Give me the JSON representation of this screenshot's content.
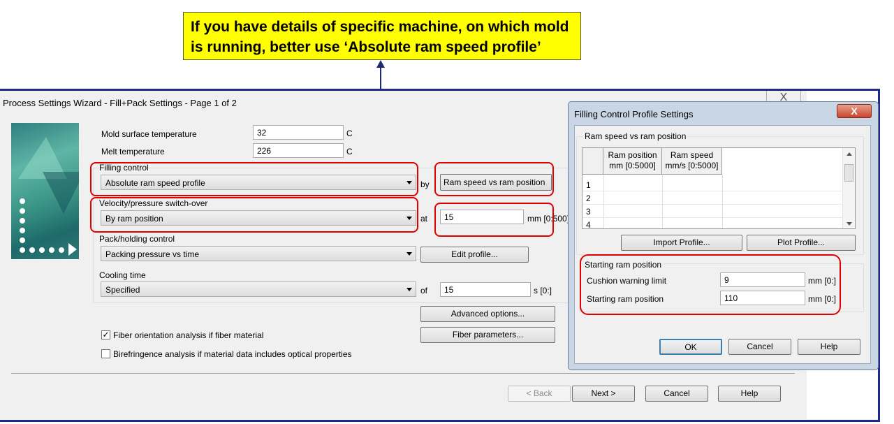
{
  "callout": {
    "line1": "If you have details of specific machine, on which mold",
    "line2": "is running, better use ‘Absolute ram speed profile’"
  },
  "main": {
    "title": "Process Settings Wizard - Fill+Pack Settings - Page 1 of 2",
    "close_glyph": "X",
    "mold_label": "Mold surface temperature",
    "mold_value": "32",
    "mold_unit": "C",
    "melt_label": "Melt temperature",
    "melt_value": "226",
    "melt_unit": "C",
    "filling_label": "Filling control",
    "filling_value": "Absolute ram speed profile",
    "by_label": "by",
    "by_value": "Ram speed vs ram position",
    "switch_label": "Velocity/pressure switch-over",
    "switch_value": "By ram position",
    "at_label": "at",
    "at_value": "15",
    "at_unit": "mm [0:500]",
    "pack_label": "Pack/holding control",
    "pack_value": "Packing pressure vs time",
    "edit_profile": "Edit profile...",
    "cooling_label": "Cooling time",
    "cooling_value": "Specified",
    "of_label": "of",
    "cooling_time": "15",
    "cooling_unit": "s [0:]",
    "advanced": "Advanced options...",
    "fiber_params": "Fiber parameters...",
    "fiber_check_label": "Fiber orientation analysis if fiber material",
    "fiber_checked": "✓",
    "biref_label": "Birefringence analysis if material data includes optical properties",
    "back": "< Back",
    "next": "Next >",
    "cancel": "Cancel",
    "help": "Help"
  },
  "sub": {
    "title": "Filling Control Profile Settings",
    "close_glyph": "X",
    "group_label": "Ram speed vs ram position",
    "col1": "Ram position mm [0:5000]",
    "col2": "Ram speed mm/s [0:5000]",
    "rows": [
      "1",
      "2",
      "3",
      "4"
    ],
    "import": "Import Profile...",
    "plot": "Plot Profile...",
    "start_group": "Starting ram position",
    "cushion_label": "Cushion warning limit",
    "cushion_value": "9",
    "cushion_unit": "mm [0:]",
    "start_label": "Starting ram position",
    "start_value": "110",
    "start_unit": "mm [0:]",
    "ok": "OK",
    "cancel": "Cancel",
    "help": "Help"
  },
  "colors": {
    "callout": "#ffff00",
    "highlight": "#e00000",
    "frame": "#1f2a8c"
  }
}
